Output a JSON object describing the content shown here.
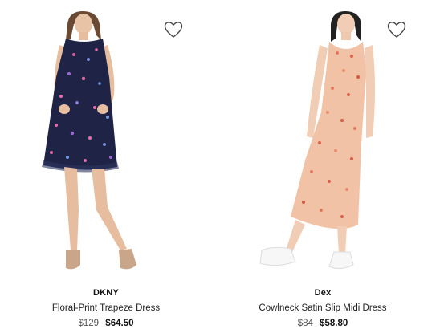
{
  "products": [
    {
      "brand": "DKNY",
      "name": "Floral-Print Trapeze Dress",
      "original_price": "$129",
      "sale_price": "$64.50",
      "image": "navy-floral-sleeveless-dress-photo",
      "wishlist_icon": "heart-outline-icon"
    },
    {
      "brand": "Dex",
      "name": "Cowlneck Satin Slip Midi Dress",
      "original_price": "$84",
      "sale_price": "$58.80",
      "image": "peach-floral-satin-slip-dress-photo",
      "wishlist_icon": "heart-outline-icon"
    }
  ],
  "colors": {
    "background": "#ffffff",
    "text": "#222222",
    "dress_navy": "#1f2446",
    "dress_peach": "#f2c2a6"
  }
}
